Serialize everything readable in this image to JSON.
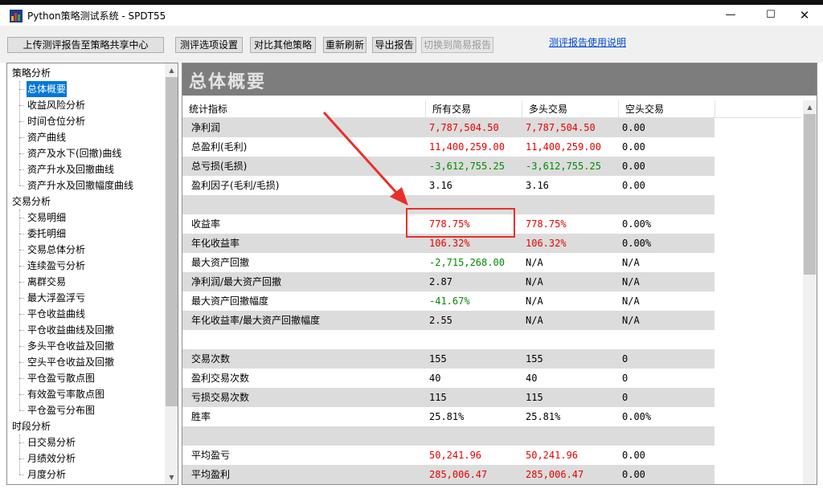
{
  "window": {
    "title": "Python策略测试系统 - SPDT55",
    "minimize": "—",
    "maximize": "☐",
    "close": "✕"
  },
  "toolbar": {
    "upload": "上传测评报告至策略共享中心",
    "options": "测评选项设置",
    "compare": "对比其他策略",
    "refresh": "重新刷新",
    "export": "导出报告",
    "switch_simple": "切换到简易报告",
    "help": "测评报告使用说明"
  },
  "tree": {
    "categories": [
      {
        "label": "策略分析",
        "items": [
          "总体概要",
          "收益风险分析",
          "时间仓位分析",
          "资产曲线",
          "资产及水下(回撤)曲线",
          "资产升水及回撤曲线",
          "资产升水及回撤幅度曲线"
        ]
      },
      {
        "label": "交易分析",
        "items": [
          "交易明细",
          "委托明细",
          "交易总体分析",
          "连续盈亏分析",
          "离群交易",
          "最大浮盈浮亏",
          "平仓收益曲线",
          "平仓收益曲线及回撤",
          "多头平仓收益及回撤",
          "空头平仓收益及回撤",
          "平仓盈亏散点图",
          "有效盈亏率散点图",
          "平仓盈亏分布图"
        ]
      },
      {
        "label": "时段分析",
        "items": [
          "日交易分析",
          "月绩效分析",
          "月度分析"
        ]
      }
    ],
    "selected": "总体概要"
  },
  "section": {
    "title": "总体概要"
  },
  "table": {
    "headers": [
      "统计指标",
      "所有交易",
      "多头交易",
      "空头交易"
    ],
    "rows": [
      {
        "label": "净利润",
        "all": "7,787,504.50",
        "long": "7,787,504.50",
        "short": "0.00",
        "all_color": "red",
        "long_color": "red"
      },
      {
        "label": "总盈利(毛利)",
        "all": "11,400,259.00",
        "long": "11,400,259.00",
        "short": "0.00",
        "all_color": "red",
        "long_color": "red"
      },
      {
        "label": "总亏损(毛损)",
        "all": "-3,612,755.25",
        "long": "-3,612,755.25",
        "short": "0.00",
        "all_color": "green",
        "long_color": "green"
      },
      {
        "label": "盈利因子(毛利/毛损)",
        "all": "3.16",
        "long": "3.16",
        "short": "0.00",
        "all_color": "black",
        "long_color": "black"
      },
      {
        "label": "",
        "all": "",
        "long": "",
        "short": "",
        "all_color": "black",
        "long_color": "black"
      },
      {
        "label": "收益率",
        "all": "778.75%",
        "long": "778.75%",
        "short": "0.00%",
        "all_color": "red",
        "long_color": "red"
      },
      {
        "label": "年化收益率",
        "all": "106.32%",
        "long": "106.32%",
        "short": "0.00%",
        "all_color": "red",
        "long_color": "red"
      },
      {
        "label": "最大资产回撤",
        "all": "-2,715,268.00",
        "long": "N/A",
        "short": "N/A",
        "all_color": "green",
        "long_color": "black"
      },
      {
        "label": "净利润/最大资产回撤",
        "all": "2.87",
        "long": "N/A",
        "short": "N/A",
        "all_color": "black",
        "long_color": "black"
      },
      {
        "label": "最大资产回撤幅度",
        "all": "-41.67%",
        "long": "N/A",
        "short": "N/A",
        "all_color": "green",
        "long_color": "black"
      },
      {
        "label": "年化收益率/最大资产回撤幅度",
        "all": "2.55",
        "long": "N/A",
        "short": "N/A",
        "all_color": "black",
        "long_color": "black"
      },
      {
        "label": "",
        "all": "",
        "long": "",
        "short": "",
        "all_color": "black",
        "long_color": "black"
      },
      {
        "label": "交易次数",
        "all": "155",
        "long": "155",
        "short": "0",
        "all_color": "black",
        "long_color": "black"
      },
      {
        "label": "盈利交易次数",
        "all": "40",
        "long": "40",
        "short": "0",
        "all_color": "black",
        "long_color": "black"
      },
      {
        "label": "亏损交易次数",
        "all": "115",
        "long": "115",
        "short": "0",
        "all_color": "black",
        "long_color": "black"
      },
      {
        "label": "胜率",
        "all": "25.81%",
        "long": "25.81%",
        "short": "0.00%",
        "all_color": "black",
        "long_color": "black"
      },
      {
        "label": "",
        "all": "",
        "long": "",
        "short": "",
        "all_color": "black",
        "long_color": "black"
      },
      {
        "label": "平均盈亏",
        "all": "50,241.96",
        "long": "50,241.96",
        "short": "0.00",
        "all_color": "red",
        "long_color": "red"
      },
      {
        "label": "平均盈利",
        "all": "285,006.47",
        "long": "285,006.47",
        "short": "0.00",
        "all_color": "red",
        "long_color": "red"
      }
    ]
  },
  "colors": {
    "positive": "#e80000",
    "negative": "#008a00",
    "selection": "#0078d7",
    "annotation": "#e8302a",
    "section_header": "#7d7d7d"
  }
}
